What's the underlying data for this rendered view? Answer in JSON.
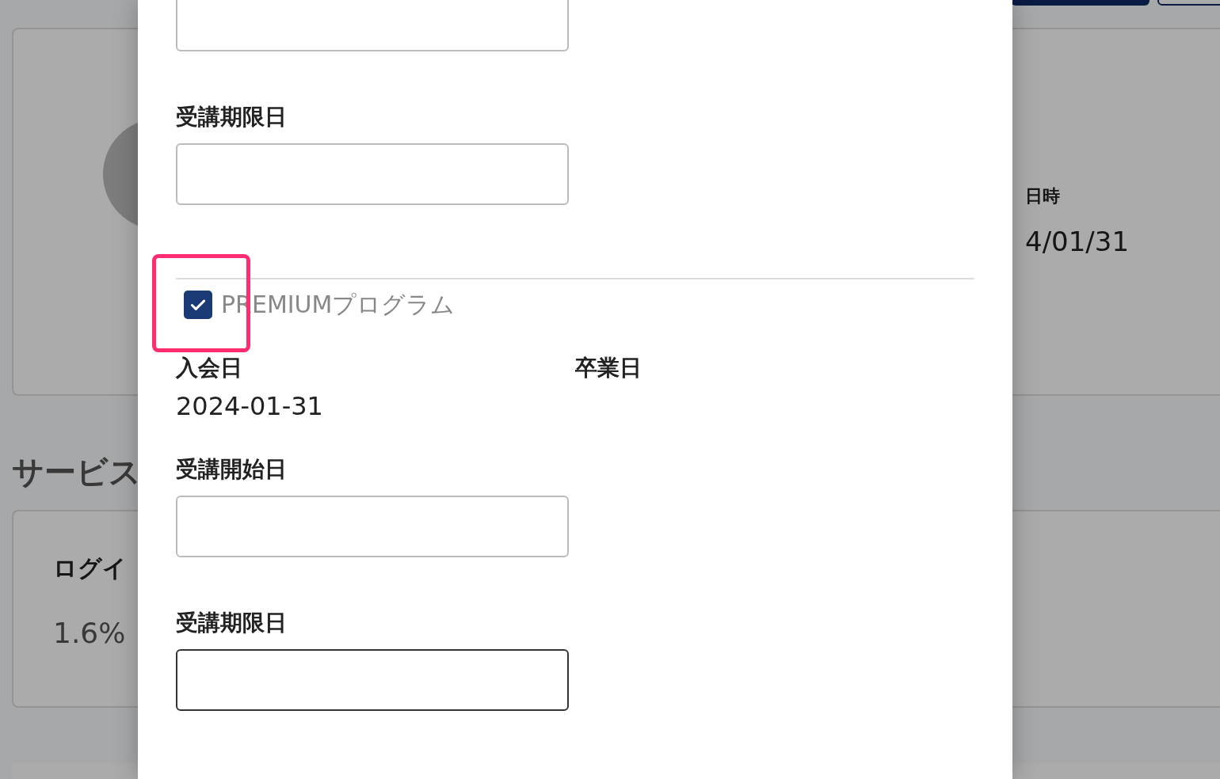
{
  "background": {
    "profile_card": {
      "column_label": "日時",
      "column_value": "4/01/31"
    },
    "section_title": "サービス",
    "stat_card": {
      "label": "ログイ",
      "value": "1.6%"
    }
  },
  "modal": {
    "items": [
      {
        "kind": "input",
        "focused": false
      },
      {
        "kind": "input",
        "label": "受講期限日",
        "focused": false
      },
      {
        "kind": "divider"
      },
      {
        "kind": "checkbox",
        "label": "PREMIUMプログラム",
        "checked": true,
        "highlighted": true
      },
      {
        "kind": "pair",
        "columns": [
          {
            "label": "入会日",
            "value": "2024-01-31"
          },
          {
            "label": "卒業日"
          }
        ]
      },
      {
        "kind": "input",
        "label": "受講開始日",
        "focused": false
      },
      {
        "kind": "input",
        "label": "受講期限日",
        "focused": true
      }
    ]
  }
}
